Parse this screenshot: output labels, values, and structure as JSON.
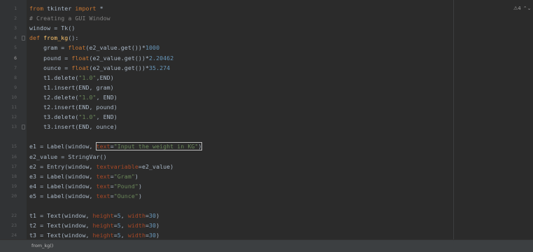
{
  "editor": {
    "inspection": {
      "label": "⚠4",
      "arrows": "⌃⌄"
    },
    "current_line": 6,
    "gutter_numbers": [
      "1",
      "2",
      "3",
      "4",
      "5",
      "6",
      "7",
      "8",
      "9",
      "10",
      "11",
      "12",
      "13",
      "",
      "15",
      "16",
      "17",
      "18",
      "19",
      "20",
      "",
      "22",
      "23",
      "24"
    ],
    "lines": [
      [
        [
          "kw",
          "from "
        ],
        [
          "txt",
          "tkinter "
        ],
        [
          "kw",
          "import "
        ],
        [
          "txt",
          "*"
        ]
      ],
      [
        [
          "cm",
          "# Creating a GUI Window"
        ]
      ],
      [
        [
          "txt",
          "window = Tk()"
        ]
      ],
      [
        [
          "kw",
          "def "
        ],
        [
          "fn",
          "from_kg"
        ],
        [
          "txt",
          "():"
        ]
      ],
      [
        [
          "txt",
          "    gram = "
        ],
        [
          "kw",
          "float"
        ],
        [
          "txt",
          "(e2_value.get())*"
        ],
        [
          "num",
          "1000"
        ]
      ],
      [
        [
          "txt",
          "    pound = "
        ],
        [
          "kw",
          "float"
        ],
        [
          "txt",
          "(e2_value.get())*"
        ],
        [
          "num",
          "2.20462"
        ]
      ],
      [
        [
          "txt",
          "    ounce = "
        ],
        [
          "kw",
          "float"
        ],
        [
          "txt",
          "(e2_value.get())*"
        ],
        [
          "num",
          "35.274"
        ]
      ],
      [
        [
          "txt",
          "    t1.delete("
        ],
        [
          "str",
          "\"1.0\""
        ],
        [
          "txt",
          ",END)"
        ]
      ],
      [
        [
          "txt",
          "    t1.insert(END, gram)"
        ]
      ],
      [
        [
          "txt",
          "    t2.delete("
        ],
        [
          "str",
          "\"1.0\""
        ],
        [
          "txt",
          ", END)"
        ]
      ],
      [
        [
          "txt",
          "    t2.insert(END, pound)"
        ]
      ],
      [
        [
          "txt",
          "    t3.delete("
        ],
        [
          "str",
          "\"1.0\""
        ],
        [
          "txt",
          ", END)"
        ]
      ],
      [
        [
          "txt",
          "    t3.insert(END, ounce)"
        ]
      ],
      [],
      [
        [
          "txt",
          "e1 = Label(window, "
        ],
        [
          "param",
          "text"
        ],
        [
          "txt",
          "="
        ],
        [
          "str",
          "\"Input the weight in KG\""
        ],
        [
          "txt",
          ")"
        ]
      ],
      [
        [
          "txt",
          "e2_value = StringVar()"
        ]
      ],
      [
        [
          "txt",
          "e2 = Entry(window, "
        ],
        [
          "param",
          "textvariable"
        ],
        [
          "txt",
          "=e2_value)"
        ]
      ],
      [
        [
          "txt",
          "e3 = Label(window, "
        ],
        [
          "param",
          "text"
        ],
        [
          "txt",
          "="
        ],
        [
          "str",
          "\"Gram\""
        ],
        [
          "txt",
          ")"
        ]
      ],
      [
        [
          "txt",
          "e4 = Label(window, "
        ],
        [
          "param",
          "text"
        ],
        [
          "txt",
          "="
        ],
        [
          "str",
          "\"Pound\""
        ],
        [
          "txt",
          ")"
        ]
      ],
      [
        [
          "txt",
          "e5 = Label(window, "
        ],
        [
          "param",
          "text"
        ],
        [
          "txt",
          "="
        ],
        [
          "str",
          "\"Ounce\""
        ],
        [
          "txt",
          ")"
        ]
      ],
      [],
      [
        [
          "txt",
          "t1 = Text(window, "
        ],
        [
          "param",
          "height"
        ],
        [
          "txt",
          "="
        ],
        [
          "num",
          "5"
        ],
        [
          "txt",
          ", "
        ],
        [
          "param",
          "width"
        ],
        [
          "txt",
          "="
        ],
        [
          "num",
          "30"
        ],
        [
          "txt",
          ")"
        ]
      ],
      [
        [
          "txt",
          "t2 = Text(window, "
        ],
        [
          "param",
          "height"
        ],
        [
          "txt",
          "="
        ],
        [
          "num",
          "5"
        ],
        [
          "txt",
          ", "
        ],
        [
          "param",
          "width"
        ],
        [
          "txt",
          "="
        ],
        [
          "num",
          "30"
        ],
        [
          "txt",
          ")"
        ]
      ],
      [
        [
          "txt",
          "t3 = Text(window, "
        ],
        [
          "param",
          "height"
        ],
        [
          "txt",
          "="
        ],
        [
          "num",
          "5"
        ],
        [
          "txt",
          ", "
        ],
        [
          "param",
          "width"
        ],
        [
          "txt",
          "="
        ],
        [
          "num",
          "30"
        ],
        [
          "txt",
          ")"
        ]
      ]
    ]
  },
  "statusbar": {
    "breadcrumb": "from_kg()"
  }
}
